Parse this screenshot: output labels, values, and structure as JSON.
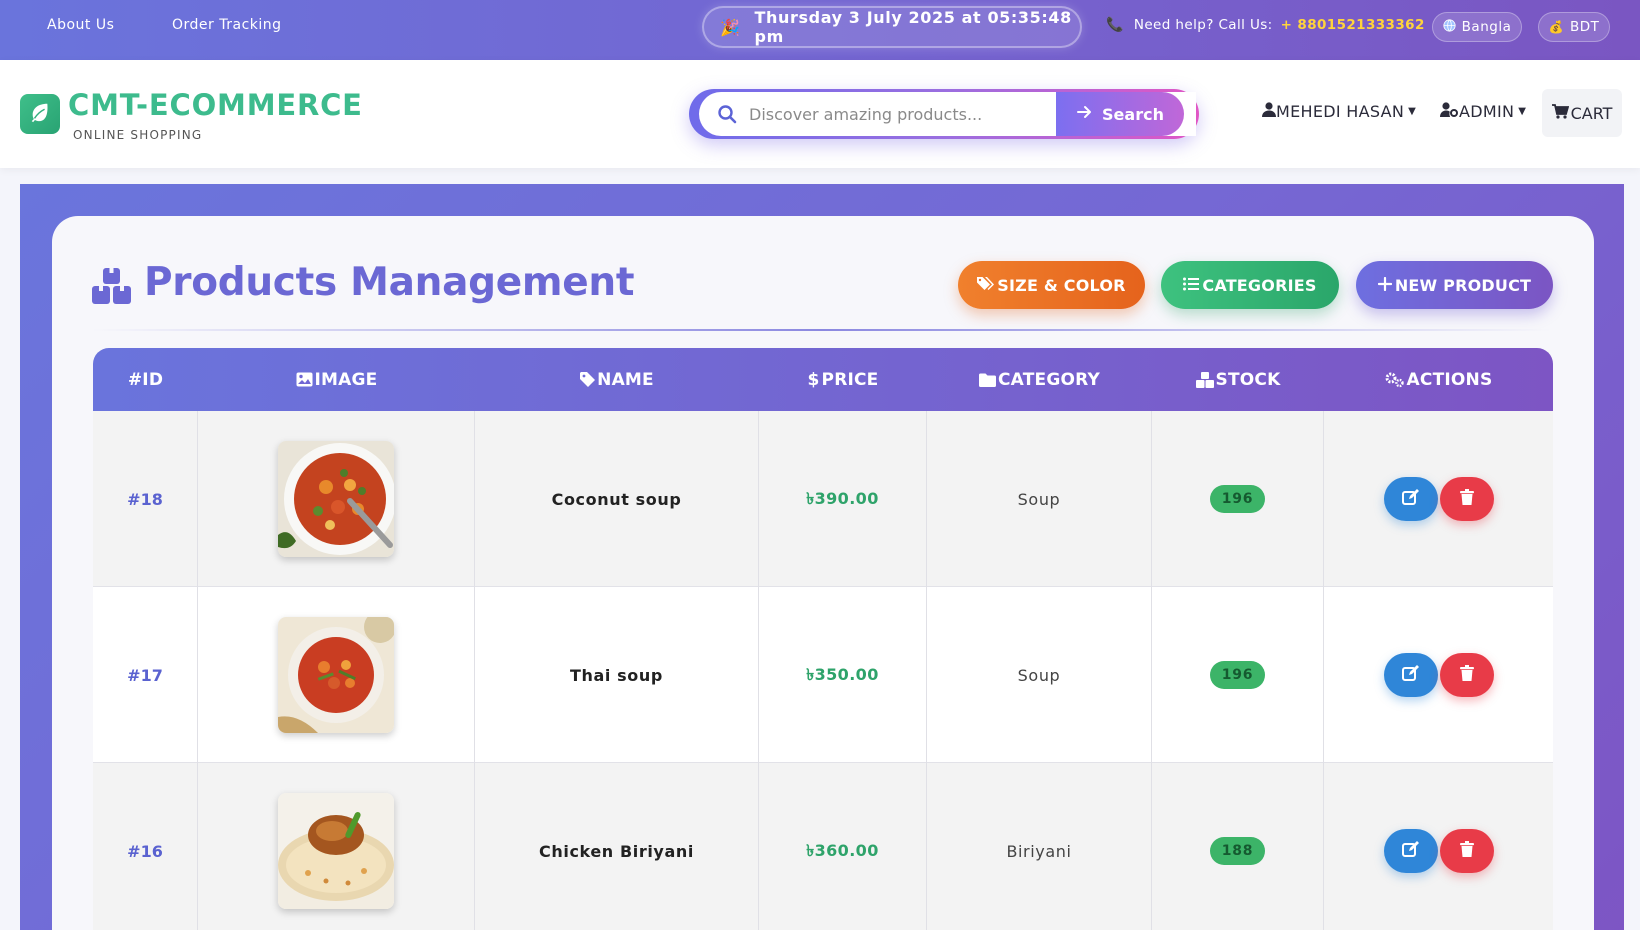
{
  "topbar": {
    "about": "About Us",
    "tracking": "Order Tracking",
    "datetime": "Thursday 3 July 2025 at 05:35:48 pm",
    "help_label": "Need help? Call Us:",
    "help_number": "+ 8801521333362",
    "language": "Bangla",
    "currency": "BDT"
  },
  "header": {
    "brand": "CMT-ECOMMERCE",
    "tagline": "ONLINE SHOPPING",
    "search_placeholder": "Discover amazing products...",
    "search_button": "Search",
    "user": "MEHEDI HASAN",
    "admin": "ADMIN",
    "cart": "CART"
  },
  "page": {
    "title": "Products Management",
    "buttons": {
      "size_color": "SIZE & COLOR",
      "categories": "CATEGORIES",
      "new_product": "NEW PRODUCT"
    }
  },
  "table": {
    "headers": {
      "id": "#ID",
      "image": "IMAGE",
      "name": "NAME",
      "price": "PRICE",
      "category": "CATEGORY",
      "stock": "STOCK",
      "actions": "ACTIONS"
    },
    "rows": [
      {
        "id": "#18",
        "name": "Coconut soup",
        "price": "৳390.00",
        "category": "Soup",
        "stock": "196"
      },
      {
        "id": "#17",
        "name": "Thai soup",
        "price": "৳350.00",
        "category": "Soup",
        "stock": "196"
      },
      {
        "id": "#16",
        "name": "Chicken Biriyani",
        "price": "৳360.00",
        "category": "Biriyani",
        "stock": "188"
      }
    ]
  },
  "icons": {
    "party": "party-popper-icon",
    "phone": "phone-icon",
    "globe": "globe-icon",
    "money": "money-bag-icon",
    "leaf": "leaf-icon",
    "search": "search-icon",
    "user": "user-icon",
    "user_cog": "user-cog-icon",
    "cart": "cart-icon",
    "boxes": "boxes-icon",
    "tags": "tags-icon",
    "list": "list-icon",
    "plus": "plus-icon",
    "image": "image-icon",
    "tag": "tag-icon",
    "dollar": "dollar-icon",
    "folder": "folder-icon",
    "cogs": "cogs-icon",
    "edit": "edit-icon",
    "trash": "trash-icon"
  },
  "colors": {
    "primary": "#6a74dc",
    "purple": "#7d55c4",
    "brand_green": "#3dbb8d",
    "orange": "#f0802d",
    "green": "#3ec27f",
    "edit_blue": "#2f86d8",
    "delete_red": "#e83b48",
    "price_green": "#2ea36a",
    "phone_yellow": "#ffd43b"
  }
}
